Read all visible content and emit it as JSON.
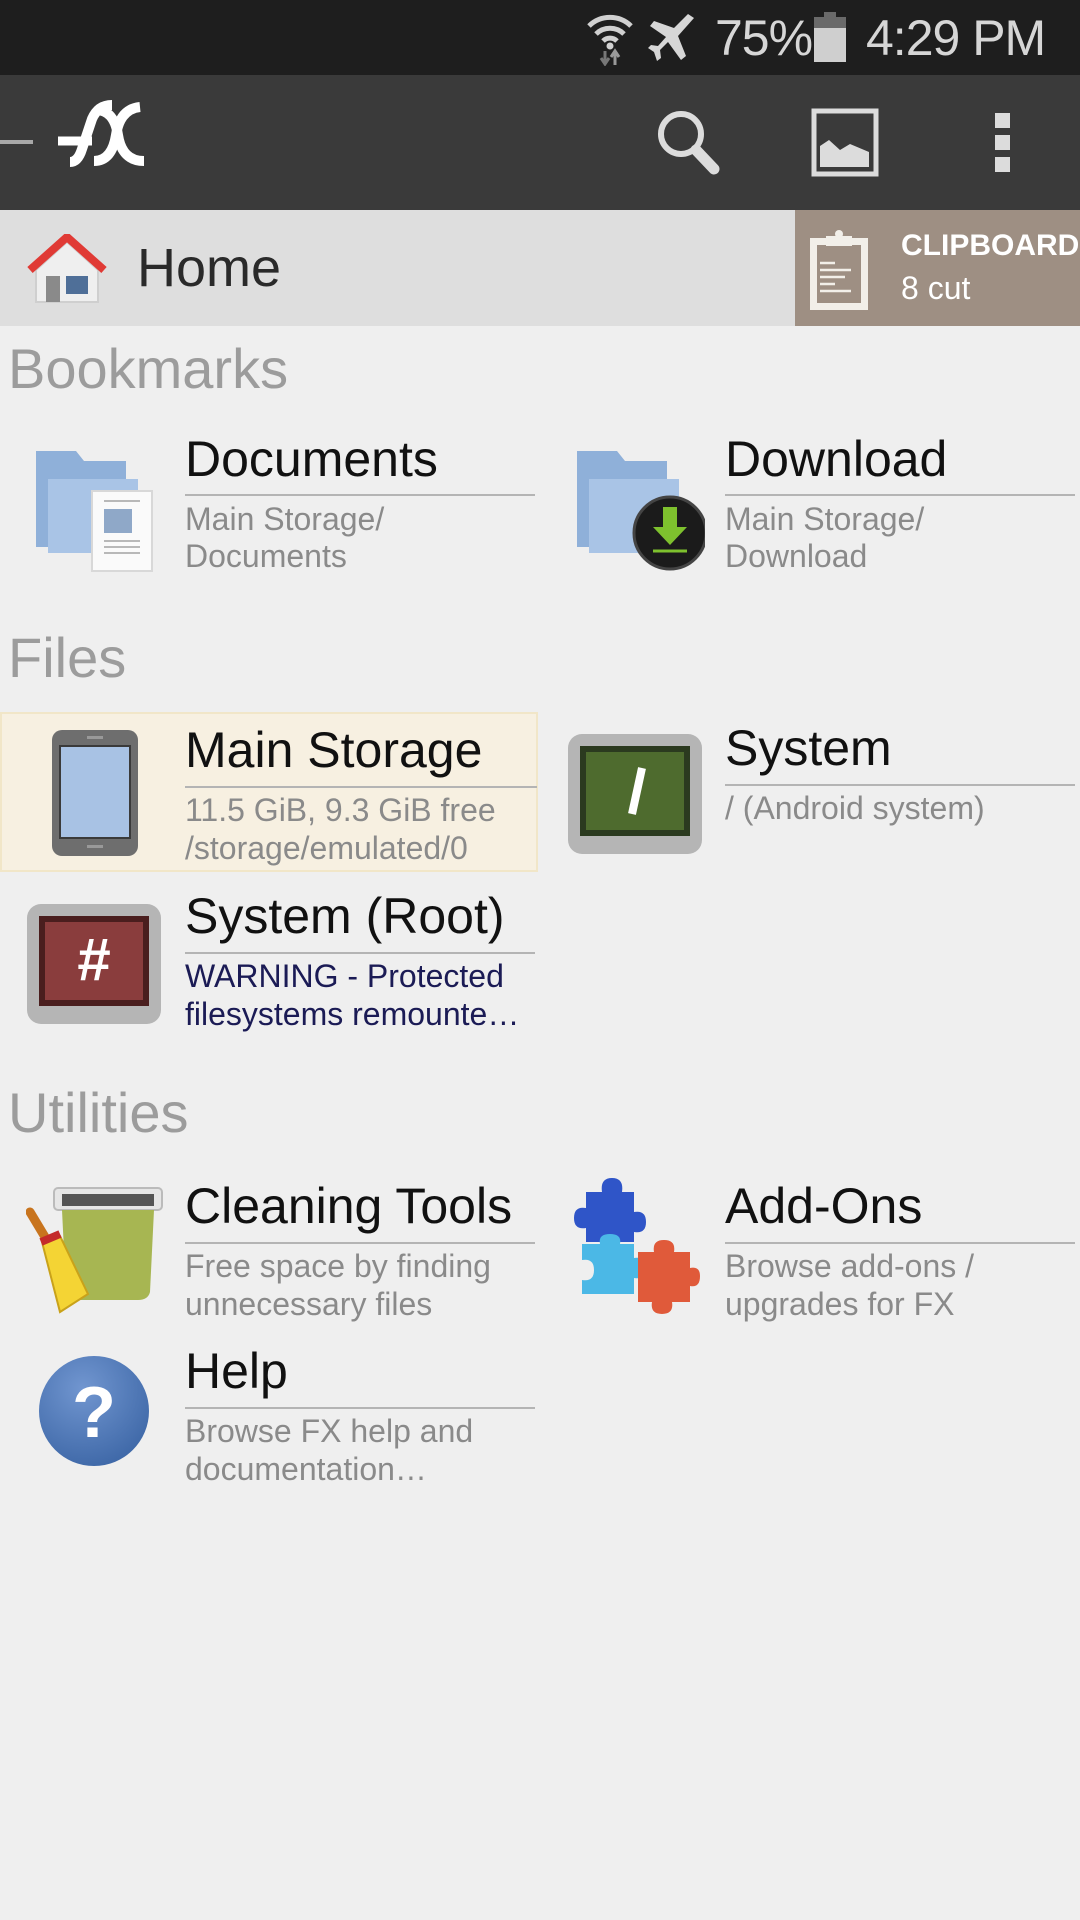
{
  "status_bar": {
    "battery_percent": "75%",
    "battery_level": 0.75,
    "time": "4:29 PM",
    "icons": [
      "wifi-icon",
      "airplane-mode-icon",
      "battery-icon"
    ]
  },
  "toolbar": {
    "app_logo": "FX",
    "icons": [
      "drawer-indicator-icon",
      "search-icon",
      "image-view-icon",
      "overflow-menu-icon"
    ]
  },
  "breadcrumb": {
    "icon": "home-icon",
    "label": "Home"
  },
  "clipboard": {
    "icon": "clipboard-icon",
    "title": "CLIPBOARD",
    "count_label": "8 cut"
  },
  "sections": {
    "bookmarks": {
      "heading": "Bookmarks",
      "items": [
        {
          "icon": "documents-folder-icon",
          "title": "Documents",
          "lines": [
            "Main Storage/",
            "Documents"
          ]
        },
        {
          "icon": "download-folder-icon",
          "title": "Download",
          "lines": [
            "Main Storage/",
            "Download"
          ]
        }
      ]
    },
    "files": {
      "heading": "Files",
      "items": [
        {
          "icon": "phone-storage-icon",
          "title": "Main Storage",
          "lines": [
            "11.5 GiB, 9.3 GiB free",
            "/storage/emulated/0"
          ],
          "selected": true
        },
        {
          "icon": "system-terminal-icon",
          "title": "System",
          "lines": [
            "/ (Android system)"
          ]
        },
        {
          "icon": "root-terminal-icon",
          "title": "System (Root)",
          "lines": [
            "WARNING - Protected",
            "filesystems remounte…"
          ],
          "warning": true
        }
      ]
    },
    "utilities": {
      "heading": "Utilities",
      "items": [
        {
          "icon": "cleaning-broom-icon",
          "title": "Cleaning Tools",
          "lines": [
            "Free space by finding",
            "unnecessary files"
          ]
        },
        {
          "icon": "puzzle-addons-icon",
          "title": "Add-Ons",
          "lines": [
            "Browse add-ons /",
            "upgrades for FX"
          ]
        },
        {
          "icon": "help-question-icon",
          "title": "Help",
          "lines": [
            "Browse FX help and",
            "documentation…"
          ]
        }
      ]
    }
  },
  "colors": {
    "status_bar_bg": "#1e1e1e",
    "toolbar_bg": "#3a3a3a",
    "breadcrumb_bg": "#dedede",
    "clipboard_bg": "#9e8f83",
    "page_bg": "#efefef",
    "selected_tile_bg": "#f7f0e1",
    "warning_text": "#1b1b55"
  }
}
